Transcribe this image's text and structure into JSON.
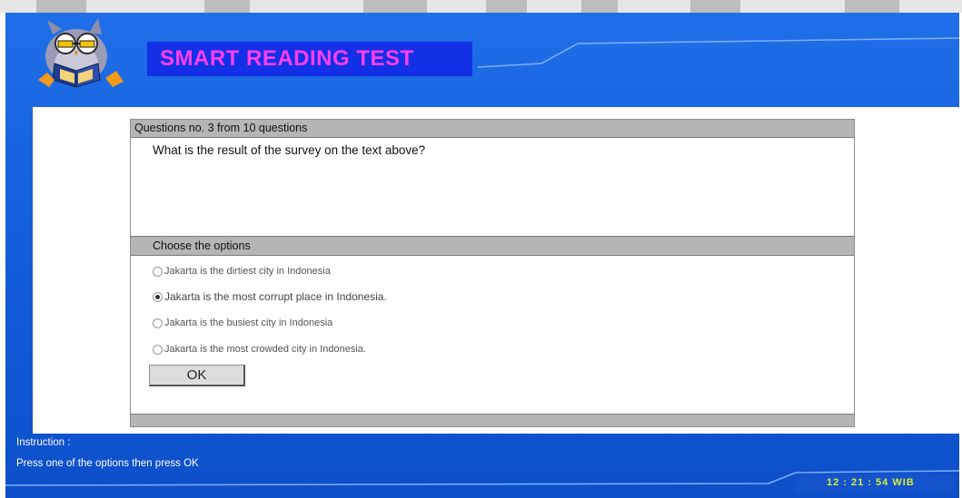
{
  "app": {
    "title": "SMART READING TEST",
    "title_color": "#ff3df2",
    "background_color": "#1560dc"
  },
  "question": {
    "header": "Questions no. 3 from 10 questions",
    "text": "What is the result of the survey on the text above?"
  },
  "options": {
    "header": "Choose the options",
    "items": [
      {
        "label": "Jakarta is the dirtiest city in Indonesia",
        "selected": false
      },
      {
        "label": "Jakarta is the most corrupt place in Indonesia.",
        "selected": true
      },
      {
        "label": "Jakarta is the busiest city in Indonesia",
        "selected": false
      },
      {
        "label": "Jakarta is the most crowded city in Indonesia.",
        "selected": false
      }
    ],
    "ok_label": "OK"
  },
  "footer": {
    "instruction_title": "Instruction :",
    "instruction_text": "Press one of the options then press OK",
    "clock": "12 : 21 : 54  WIB",
    "clock_color": "#d8ef3a"
  },
  "icons": {
    "logo": "owl-reading-book-icon",
    "radio": "radio-button-icon"
  }
}
